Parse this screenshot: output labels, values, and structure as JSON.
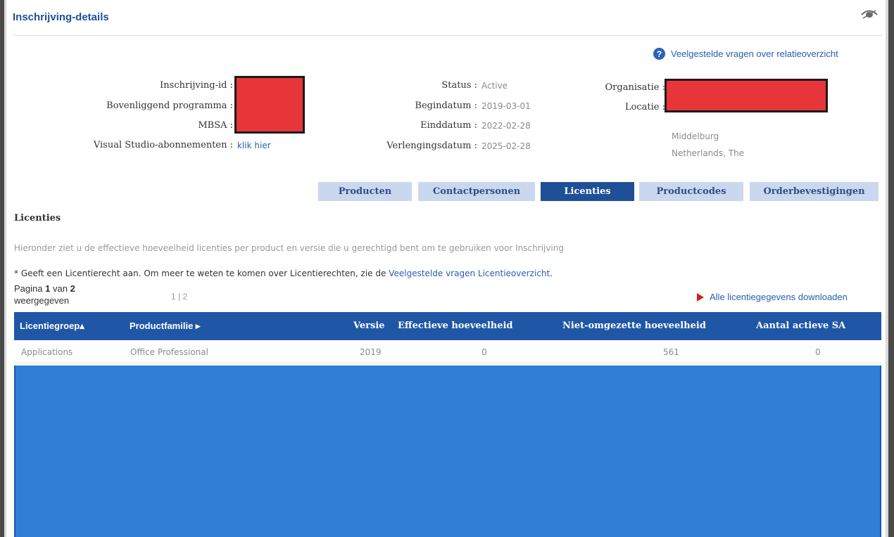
{
  "header": {
    "title": "Inschrijving-details",
    "eye_icon": "eye-icon"
  },
  "faq": {
    "icon": "help-icon",
    "icon_glyph": "?",
    "label": "Veelgestelde vragen over relatieoverzicht"
  },
  "enrollment": {
    "left": {
      "id_label": "Inschrijving-id :",
      "parent_program_label": "Bovenliggend programma :",
      "mbsa_label": "MBSA :",
      "vs_label": "Visual Studio-abonnementen :",
      "vs_link": "klik hier"
    },
    "middle": {
      "status_label": "Status :",
      "status_value": "Active",
      "start_label": "Begindatum :",
      "start_value": "2019-03-01",
      "end_label": "Einddatum :",
      "end_value": "2022-02-28",
      "renewal_label": "Verlengingsdatum :",
      "renewal_value": "2025-02-28"
    },
    "right": {
      "org_label": "Organisatie :",
      "location_label": "Locatie :",
      "city": "Middelburg",
      "country": "Netherlands, The"
    },
    "redaction_color": "#e8353a"
  },
  "tabs": [
    {
      "label": "Producten",
      "active": false
    },
    {
      "label": "Contactpersonen",
      "active": false
    },
    {
      "label": "Licenties",
      "active": true
    },
    {
      "label": "Productcodes",
      "active": false
    },
    {
      "label": "Orderbevestigingen",
      "active": false
    }
  ],
  "licenses": {
    "section_title": "Licenties",
    "description": "Hieronder ziet u de effectieve hoeveelheid licenties per product en versie die u gerechtigd bent om te gebruiken voor Inschrijving",
    "note_prefix": "* Geeft een Licentierecht aan. Om meer te weten te komen over Licentierechten, zie de",
    "note_link": "Veelgestelde vragen Licentieoverzicht",
    "note_suffix": ".",
    "paging": {
      "prefix": "Pagina",
      "current": "1",
      "middle": "van",
      "total": "2",
      "suffix": "weergegeven",
      "links": "1 | 2"
    },
    "download_label": "Alle licentiegegevens downloaden",
    "download_icon": "play-icon",
    "columns": [
      "Licentiegroep",
      "Productfamilie",
      "Versie",
      "Effectieve hoeveelheid",
      "Niet-omgezette hoeveelheid",
      "Aantal actieve SA"
    ],
    "sort_indicators": {
      "group": "▴",
      "family": "▸"
    },
    "rows": [
      [
        "Applications",
        "Office Professional",
        "2019",
        "0",
        "561",
        "0"
      ]
    ],
    "header_color": "#1f57a6",
    "fill_color": "#2f7fd6"
  }
}
